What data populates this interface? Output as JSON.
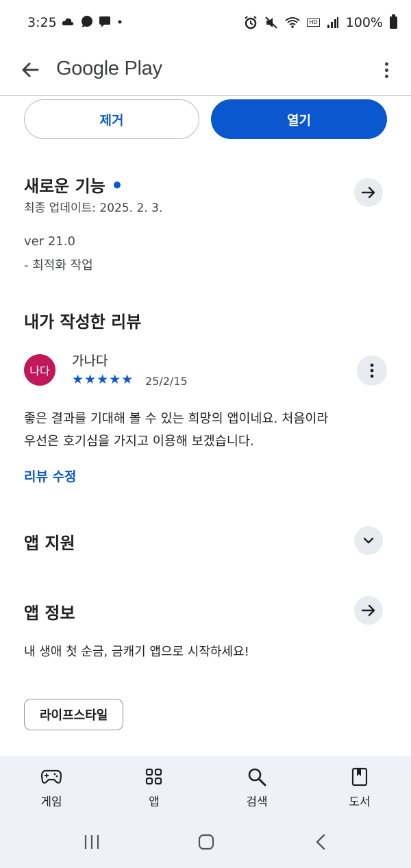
{
  "status_bar": {
    "time": "3:25",
    "left_icons": [
      "cloud-icon",
      "chat-bubble-icon",
      "message-icon",
      "dot-icon"
    ],
    "right_icons": [
      "alarm-icon",
      "mute-icon",
      "wifi-icon",
      "hd-voice-icon",
      "signal-icon"
    ],
    "hd_label": "HD",
    "battery": "100%"
  },
  "app_bar": {
    "title": "Google Play"
  },
  "actions": {
    "remove_label": "제거",
    "open_label": "열기"
  },
  "whats_new": {
    "title": "새로운 기능",
    "last_updated": "최종 업데이트: 2025. 2. 3.",
    "version": "ver 21.0",
    "notes": "- 최적화 작업"
  },
  "my_review": {
    "section_title": "내가 작성한 리뷰",
    "avatar_text": "나다",
    "reviewer": "가나다",
    "stars": "★★★★★",
    "rating": 5,
    "date": "25/2/15",
    "text_line1": "좋은 결과를 기대해 볼 수 있는 희망의 앱이네요. 처음이라",
    "text_line2": "우선은 호기심을 가지고 이용해 보겠습니다.",
    "edit_label": "리뷰 수정"
  },
  "app_support": {
    "title": "앱 지원"
  },
  "app_info": {
    "title": "앱 정보",
    "description": "내 생애 첫 순금, 금캐기 앱으로 시작하세요!",
    "tag": "라이프스타일"
  },
  "bottom_nav": {
    "games": "게임",
    "apps": "앱",
    "search": "검색",
    "books": "도서"
  },
  "colors": {
    "accent": "#0b57d0",
    "avatar": "#c2185b",
    "nav_bg": "#eef2f8"
  }
}
